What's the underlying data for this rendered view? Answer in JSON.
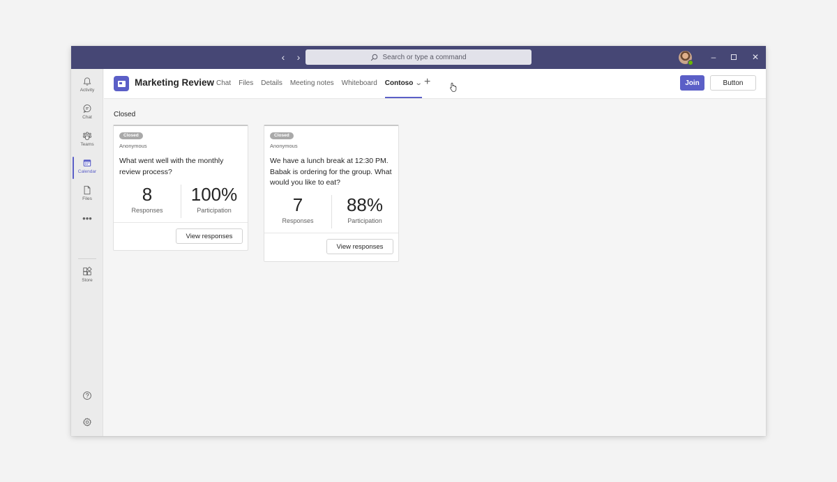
{
  "titlebar": {
    "search_placeholder": "Search or type a command"
  },
  "rail": {
    "items": [
      {
        "label": "Activity",
        "icon": "bell-icon"
      },
      {
        "label": "Chat",
        "icon": "chat-icon"
      },
      {
        "label": "Teams",
        "icon": "teams-icon"
      },
      {
        "label": "Calendar",
        "icon": "calendar-icon"
      },
      {
        "label": "Files",
        "icon": "file-icon"
      },
      {
        "label": "Store",
        "icon": "store-icon"
      }
    ],
    "more": "•••",
    "active": "Calendar"
  },
  "header": {
    "title": "Marketing Review",
    "tabs": [
      "Chat",
      "Files",
      "Details",
      "Meeting notes",
      "Whiteboard",
      "Contoso"
    ],
    "active_tab": "Contoso",
    "join_label": "Join",
    "button_label": "Button"
  },
  "section_label": "Closed",
  "cards": [
    {
      "badge": "Closed",
      "anon": "Anonymous",
      "question": "What went well with the monthly review process?",
      "responses": "8",
      "responses_label": "Responses",
      "participation": "100%",
      "participation_label": "Participation",
      "action": "View responses"
    },
    {
      "badge": "Closed",
      "anon": "Anonymous",
      "question": "We have a lunch break at 12:30 PM. Babak is ordering for the group. What would you like to eat?",
      "responses": "7",
      "responses_label": "Responses",
      "participation": "88%",
      "participation_label": "Participation",
      "action": "View responses"
    }
  ],
  "colors": {
    "titlebar": "#464775",
    "accent": "#5b5fc7",
    "badge": "#a9a9a9"
  }
}
